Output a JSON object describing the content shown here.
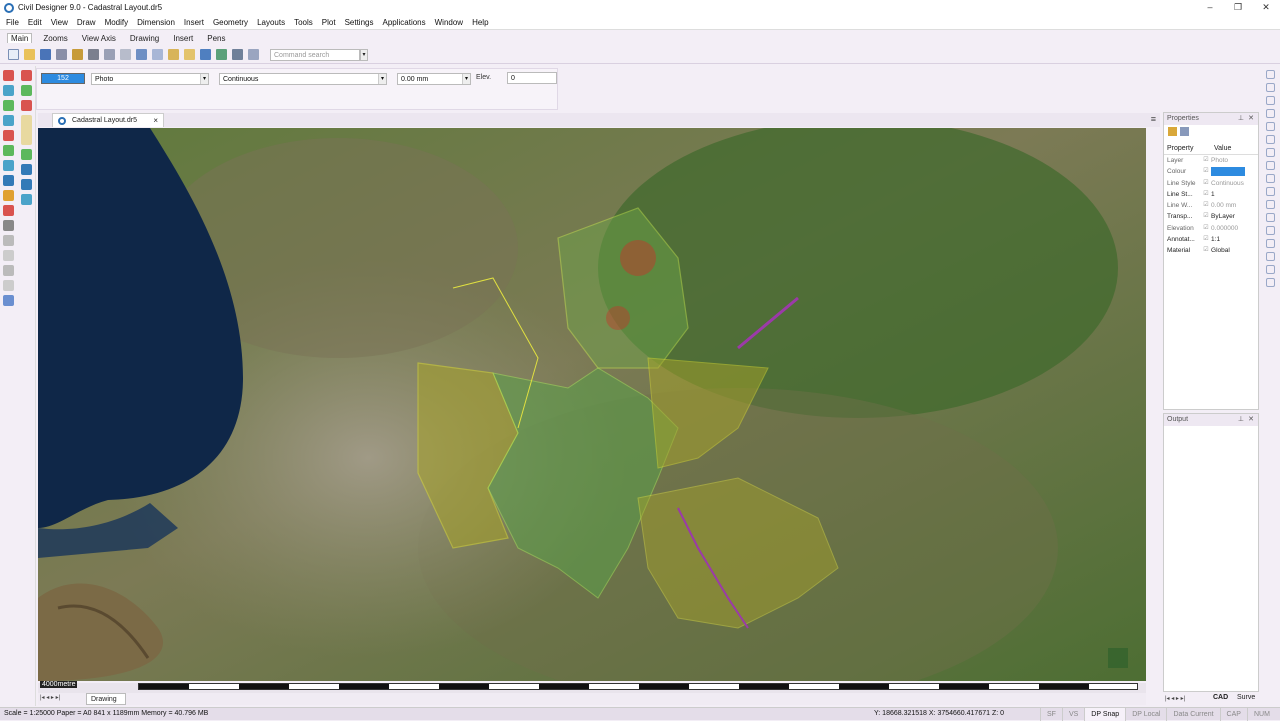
{
  "window": {
    "title": "Civil Designer 9.0 - Cadastral Layout.dr5",
    "buttons": [
      "–",
      "❐",
      "✕"
    ]
  },
  "menu": [
    "File",
    "Edit",
    "View",
    "Draw",
    "Modify",
    "Dimension",
    "Insert",
    "Geometry",
    "Layouts",
    "Tools",
    "Plot",
    "Settings",
    "Applications",
    "Window",
    "Help"
  ],
  "ribbon_tabs": [
    "Main",
    "Zooms",
    "View Axis",
    "Drawing",
    "Insert",
    "Pens"
  ],
  "toolbar": {
    "command_search_placeholder": "Command search"
  },
  "property_bar": {
    "colour": "152",
    "layer": "Photo",
    "linetype": "Continuous",
    "lineweight": "0.00 mm",
    "elev_label": "Elev.",
    "elev_value": "0"
  },
  "document": {
    "tab_label": "Cadastral Layout.dr5",
    "close": "×"
  },
  "viewport": {
    "scale_label": "4000metre"
  },
  "layout_tabs": {
    "drawing": "Drawing"
  },
  "properties_panel": {
    "title": "Properties",
    "col_property": "Property",
    "col_value": "Value",
    "rows": [
      {
        "name": "Layer",
        "value": "Photo"
      },
      {
        "name": "Colour",
        "value": ""
      },
      {
        "name": "Line Style",
        "value": "Continuous"
      },
      {
        "name": "Line St...",
        "value": "1"
      },
      {
        "name": "Line W...",
        "value": "0.00 mm"
      },
      {
        "name": "Transp...",
        "value": "ByLayer"
      },
      {
        "name": "Elevation",
        "value": "0.000000"
      },
      {
        "name": "Annotat...",
        "value": "1:1"
      },
      {
        "name": "Material",
        "value": "Global"
      }
    ],
    "colour_hex": "#2d8be0"
  },
  "output_panel": {
    "title": "Output"
  },
  "right_tabs": {
    "cad": "CAD",
    "surv": "Surve"
  },
  "statusbar": {
    "left": "Scale = 1:25000  Paper = A0 841 x 1189mm  Memory = 40.796 MB",
    "coords": "Y: 18668.321518  X: 3754660.417671  Z: 0",
    "flags": [
      {
        "label": "SF",
        "on": false
      },
      {
        "label": "VS",
        "on": false
      },
      {
        "label": "DP Snap",
        "on": true
      },
      {
        "label": "DP Local",
        "on": false
      },
      {
        "label": "Data Current",
        "on": false
      },
      {
        "label": "CAP",
        "on": false
      },
      {
        "label": "NUM",
        "on": false
      }
    ]
  },
  "colors": {
    "accent": "#2d8be0",
    "chrome": "#f3eef6"
  }
}
